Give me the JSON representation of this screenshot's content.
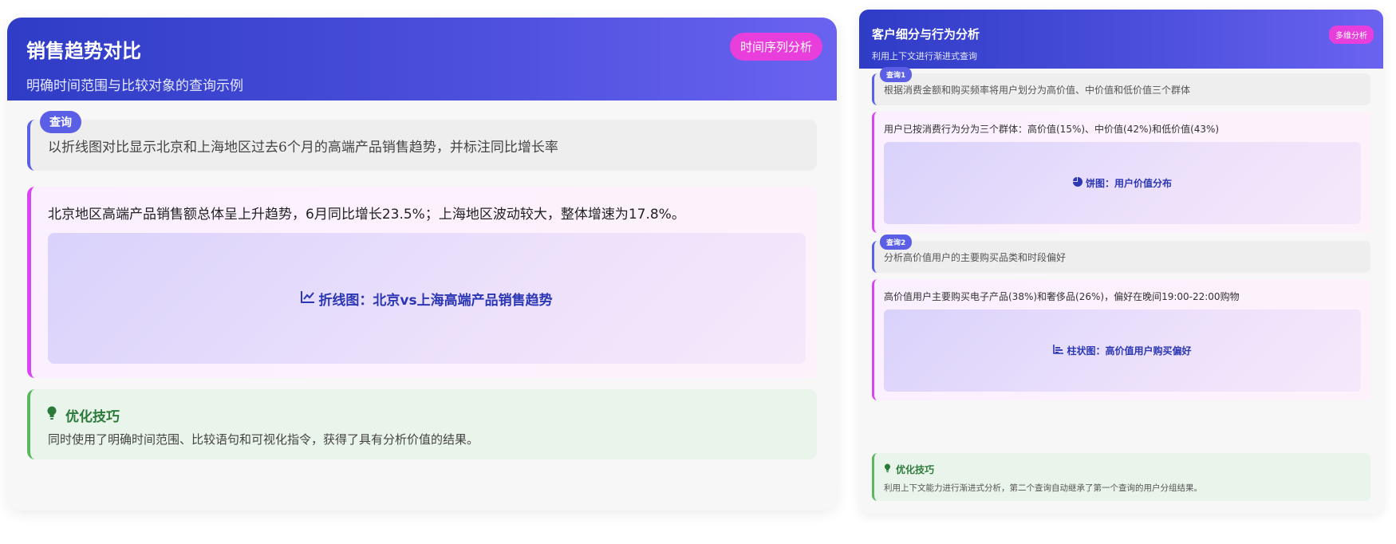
{
  "left_card": {
    "title": "销售趋势对比",
    "subtitle": "明确时间范围与比较对象的查询示例",
    "tag": "时间序列分析",
    "query": {
      "badge": "查询",
      "text": "以折线图对比显示北京和上海地区过去6个月的高端产品销售趋势，并标注同比增长率"
    },
    "answer": {
      "text": "北京地区高端产品销售额总体呈上升趋势，6月同比增长23.5%；上海地区波动较大，整体增速为17.8%。",
      "chart_label": "折线图：北京vs上海高端产品销售趋势",
      "chart_icon": "line-chart-icon"
    },
    "tip": {
      "icon": "lightbulb-icon",
      "title": "优化技巧",
      "text": "同时使用了明确时间范围、比较语句和可视化指令，获得了具有分析价值的结果。"
    }
  },
  "right_card": {
    "title": "客户细分与行为分析",
    "subtitle": "利用上下文进行渐进式查询",
    "tag": "多维分析",
    "query1": {
      "badge": "查询1",
      "text": "根据消费金额和购买频率将用户划分为高价值、中价值和低价值三个群体"
    },
    "answer1": {
      "text": "用户已按消费行为分为三个群体：高价值(15%)、中价值(42%)和低价值(43%)",
      "chart_label": "饼图：用户价值分布",
      "chart_icon": "pie-chart-icon"
    },
    "query2": {
      "badge": "查询2",
      "text": "分析高价值用户的主要购买品类和时段偏好"
    },
    "answer2": {
      "text": "高价值用户主要购买电子产品(38%)和奢侈品(26%)，偏好在晚间19:00-22:00购物",
      "chart_label": "柱状图：高价值用户购买偏好",
      "chart_icon": "bar-chart-icon"
    },
    "tip": {
      "icon": "lightbulb-icon",
      "title": "优化技巧",
      "text": "利用上下文能力进行渐进式分析，第二个查询自动继承了第一个查询的用户分组结果。"
    }
  },
  "colors": {
    "header_gradient_start": "#2f3cc6",
    "header_gradient_end": "#6a63f0",
    "tag_pink": "#e83fdc",
    "query_accent": "#5b5fe6",
    "answer_accent": "#d946ef",
    "tip_green": "#5cb85c",
    "tip_text_green": "#2c7a3a"
  }
}
